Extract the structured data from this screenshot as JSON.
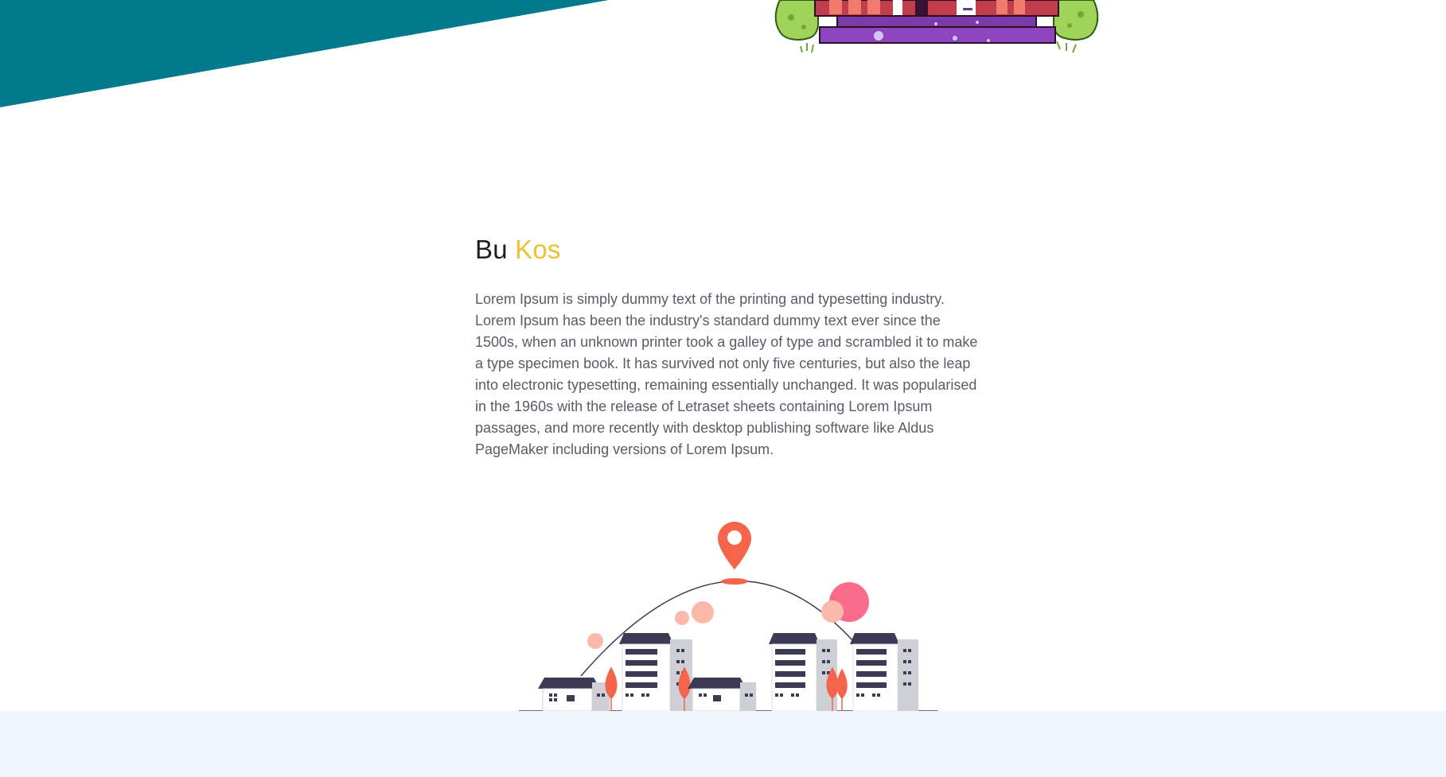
{
  "about": {
    "title_prefix": "Bu",
    "title_accent": "Kos",
    "body": "Lorem Ipsum is simply dummy text of the printing and typesetting industry. Lorem Ipsum has been the industry's standard dummy text ever since the 1500s, when an unknown printer took a galley of type and scrambled it to make a type specimen book. It has survived not only five centuries, but also the leap into electronic typesetting, remaining essentially unchanged. It was popularised in the 1960s with the release of Letraset sheets containing Lorem Ipsum passages, and more recently with desktop publishing software like Aldus PageMaker including versions of Lorem Ipsum."
  },
  "colors": {
    "teal": "#007a8c",
    "accent_yellow": "#f0bf32",
    "pin_red": "#f5654c",
    "footer_bg": "#eff6fd"
  },
  "icons": {
    "location": "map-pin-icon"
  }
}
